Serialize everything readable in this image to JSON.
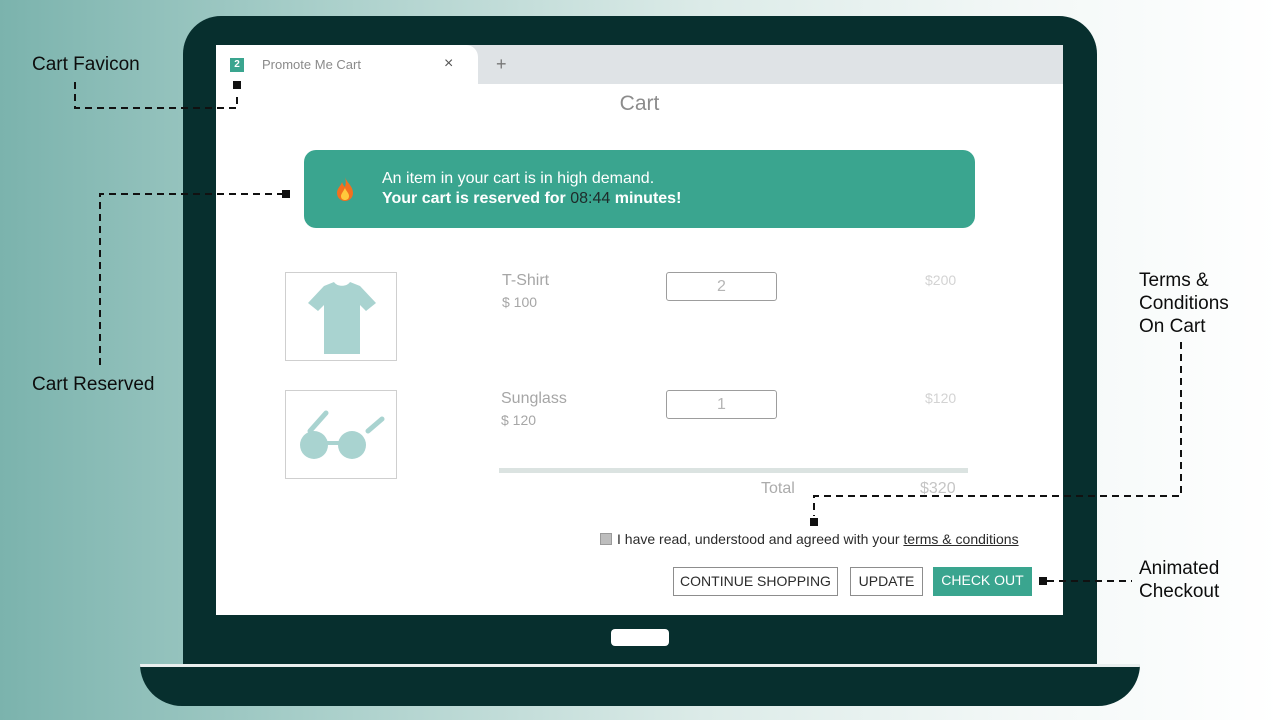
{
  "browser": {
    "tab_badge": "2",
    "tab_title": "Promote Me Cart",
    "tab_close": "×",
    "new_tab": "+"
  },
  "page": {
    "title": "Cart"
  },
  "alert": {
    "line1": "An item in your cart is in high demand.",
    "line2_prefix": "Your cart is reserved for ",
    "timer": "08:44",
    "line2_suffix": " minutes!",
    "icon": "flame-icon"
  },
  "cart": {
    "items": [
      {
        "name": "T-Shirt",
        "price": "$ 100",
        "quantity": "2",
        "line_total": "$200",
        "icon": "tshirt-icon"
      },
      {
        "name": "Sunglass",
        "price": "$ 120",
        "quantity": "1",
        "line_total": "$120",
        "icon": "sunglasses-icon"
      }
    ],
    "total_label": "Total",
    "total_value": "$320"
  },
  "terms": {
    "text": "I have read, understood and agreed with your ",
    "link": "terms & conditions"
  },
  "buttons": {
    "continue_shopping": "CONTINUE SHOPPING",
    "update": "UPDATE",
    "checkout": "CHECK OUT"
  },
  "callouts": {
    "cart_favicon": "Cart Favicon",
    "cart_reserved": "Cart Reserved",
    "terms_line1": "Terms &",
    "terms_line2": "Conditions",
    "terms_line3": "On Cart",
    "checkout_line1": "Animated",
    "checkout_line2": "Checkout"
  },
  "colors": {
    "accent": "#3aa58f",
    "laptop": "#072f2e",
    "product_icon": "#a9d3d0"
  }
}
